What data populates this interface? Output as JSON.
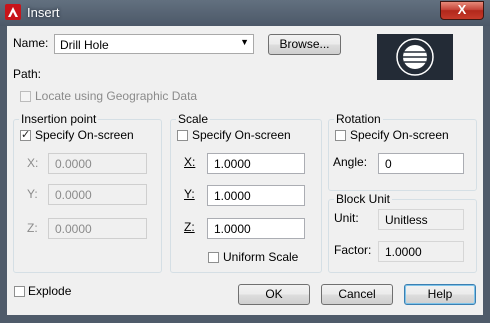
{
  "window": {
    "title": "Insert",
    "close": "X"
  },
  "name": {
    "label": "Name:",
    "value": "Drill Hole",
    "browse": "Browse..."
  },
  "path": {
    "label": "Path:"
  },
  "geo": {
    "label": "Locate using Geographic Data",
    "checked": false
  },
  "insertion": {
    "title": "Insertion point",
    "specify": "Specify On-screen",
    "specify_checked": true,
    "x_label": "X:",
    "x": "0.0000",
    "y_label": "Y:",
    "y": "0.0000",
    "z_label": "Z:",
    "z": "0.0000"
  },
  "scale": {
    "title": "Scale",
    "specify": "Specify On-screen",
    "specify_checked": false,
    "x_label": "X:",
    "x": "1.0000",
    "y_label": "Y:",
    "y": "1.0000",
    "z_label": "Z:",
    "z": "1.0000",
    "uniform": "Uniform Scale",
    "uniform_checked": false
  },
  "rotation": {
    "title": "Rotation",
    "specify": "Specify On-screen",
    "specify_checked": false,
    "angle_label": "Angle:",
    "angle": "0"
  },
  "block_unit": {
    "title": "Block Unit",
    "unit_label": "Unit:",
    "unit": "Unitless",
    "factor_label": "Factor:",
    "factor": "1.0000"
  },
  "explode": {
    "label": "Explode",
    "checked": false
  },
  "buttons": {
    "ok": "OK",
    "cancel": "Cancel",
    "help": "Help"
  }
}
